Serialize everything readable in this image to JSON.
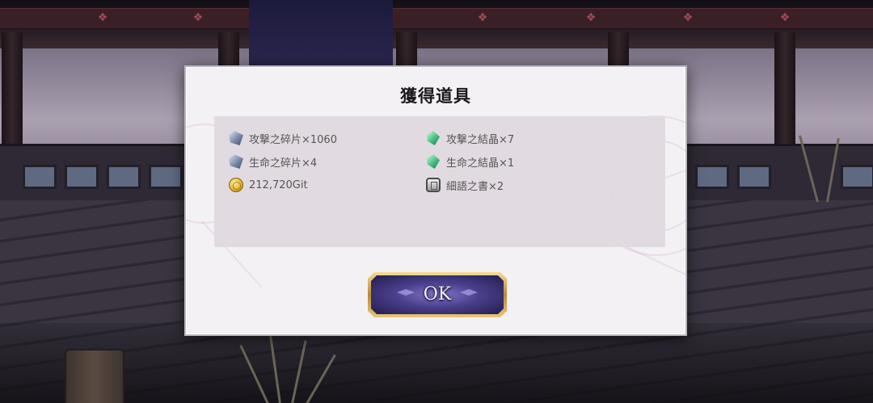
{
  "dialog": {
    "title": "獲得道具",
    "items": [
      {
        "name": "攻撃之碎片×1060",
        "icon": "attack-shard-icon"
      },
      {
        "name": "攻撃之結晶×7",
        "icon": "attack-crystal-icon"
      },
      {
        "name": "生命之碎片×4",
        "icon": "life-shard-icon"
      },
      {
        "name": "生命之結晶×1",
        "icon": "life-crystal-icon"
      },
      {
        "name": "212,720Git",
        "icon": "gold-coin-icon"
      },
      {
        "name": "細語之書×2",
        "icon": "whisper-book-icon"
      }
    ],
    "ok_label": "OK"
  },
  "colors": {
    "dialog_bg": "#f4f1f5",
    "panel_bg": "#e0d8de",
    "button_fill": "#4a3f8c",
    "button_border": "#d9b765"
  }
}
